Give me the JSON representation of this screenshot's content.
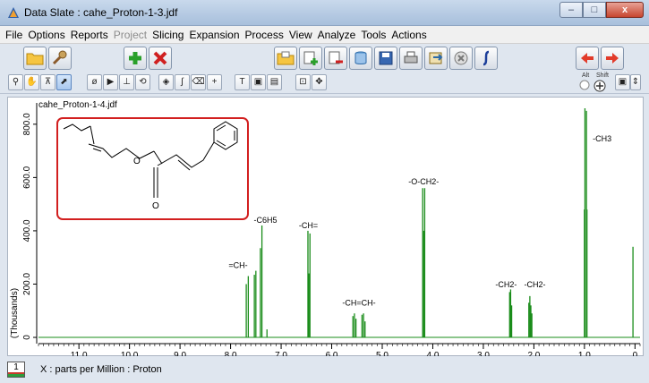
{
  "window": {
    "title": "Data Slate : cahe_Proton-1-3.jdf",
    "minimize": "–",
    "maximize": "□",
    "close": "x"
  },
  "menu": [
    "File",
    "Options",
    "Reports",
    "Project",
    "Slicing",
    "Expansion",
    "Process",
    "View",
    "Analyze",
    "Tools",
    "Actions"
  ],
  "menu_disabled": [
    "Project"
  ],
  "toolbar": {
    "alt_label": "Alt",
    "shift_label": "Shift"
  },
  "plot": {
    "filename": "cahe_Proton-1-4.jdf",
    "structure_label": "O"
  },
  "status": {
    "page": "1",
    "x_axis_text": "X : parts per Million : Proton"
  },
  "chart_data": {
    "type": "line",
    "color": "#1a8c1a",
    "xlabel": "X : parts per Million : Proton",
    "ylabel": "(Thousands)",
    "xlim": [
      11.8,
      -0.1
    ],
    "ylim": [
      -10,
      880
    ],
    "x_ticks": [
      "11.0",
      "10.0",
      "9.0",
      "8.0",
      "7.0",
      "6.0",
      "5.0",
      "4.0",
      "3.0",
      "2.0",
      "1.0",
      "0"
    ],
    "x_tick_values": [
      11,
      10,
      9,
      8,
      7,
      6,
      5,
      4,
      3,
      2,
      1,
      0
    ],
    "y_ticks": [
      "0",
      "200.0",
      "400.0",
      "600.0",
      "800.0"
    ],
    "y_tick_values": [
      0,
      200,
      400,
      600,
      800
    ],
    "peaks": [
      {
        "x": 7.69,
        "y": 200
      },
      {
        "x": 7.65,
        "y": 230
      },
      {
        "x": 7.53,
        "y": 235
      },
      {
        "x": 7.5,
        "y": 250
      },
      {
        "x": 7.41,
        "y": 335
      },
      {
        "x": 7.38,
        "y": 420
      },
      {
        "x": 7.28,
        "y": 30
      },
      {
        "x": 6.47,
        "y": 400
      },
      {
        "x": 6.45,
        "y": 240
      },
      {
        "x": 6.43,
        "y": 390
      },
      {
        "x": 5.58,
        "y": 80
      },
      {
        "x": 5.55,
        "y": 90
      },
      {
        "x": 5.52,
        "y": 70
      },
      {
        "x": 5.4,
        "y": 85
      },
      {
        "x": 5.37,
        "y": 90
      },
      {
        "x": 5.34,
        "y": 60
      },
      {
        "x": 4.2,
        "y": 560
      },
      {
        "x": 4.18,
        "y": 400
      },
      {
        "x": 4.16,
        "y": 560
      },
      {
        "x": 2.48,
        "y": 170
      },
      {
        "x": 2.46,
        "y": 180
      },
      {
        "x": 2.44,
        "y": 120
      },
      {
        "x": 2.1,
        "y": 130
      },
      {
        "x": 2.08,
        "y": 155
      },
      {
        "x": 2.06,
        "y": 120
      },
      {
        "x": 2.04,
        "y": 90
      },
      {
        "x": 1.0,
        "y": 480
      },
      {
        "x": 0.99,
        "y": 860
      },
      {
        "x": 0.96,
        "y": 850
      },
      {
        "x": 0.95,
        "y": 480
      },
      {
        "x": 0.04,
        "y": 340
      }
    ],
    "annotations": [
      {
        "text": "=CH-",
        "x": 7.85,
        "y": 260
      },
      {
        "text": "-C6H5",
        "x": 7.31,
        "y": 430
      },
      {
        "text": "-CH=",
        "x": 6.46,
        "y": 410
      },
      {
        "text": "-CH=CH-",
        "x": 5.46,
        "y": 120
      },
      {
        "text": "-O-CH2-",
        "x": 4.18,
        "y": 575
      },
      {
        "text": "-CH2-",
        "x": 2.55,
        "y": 188
      },
      {
        "text": "-CH2-",
        "x": 1.98,
        "y": 188
      },
      {
        "text": "-CH3",
        "x": 0.65,
        "y": 735
      }
    ]
  }
}
